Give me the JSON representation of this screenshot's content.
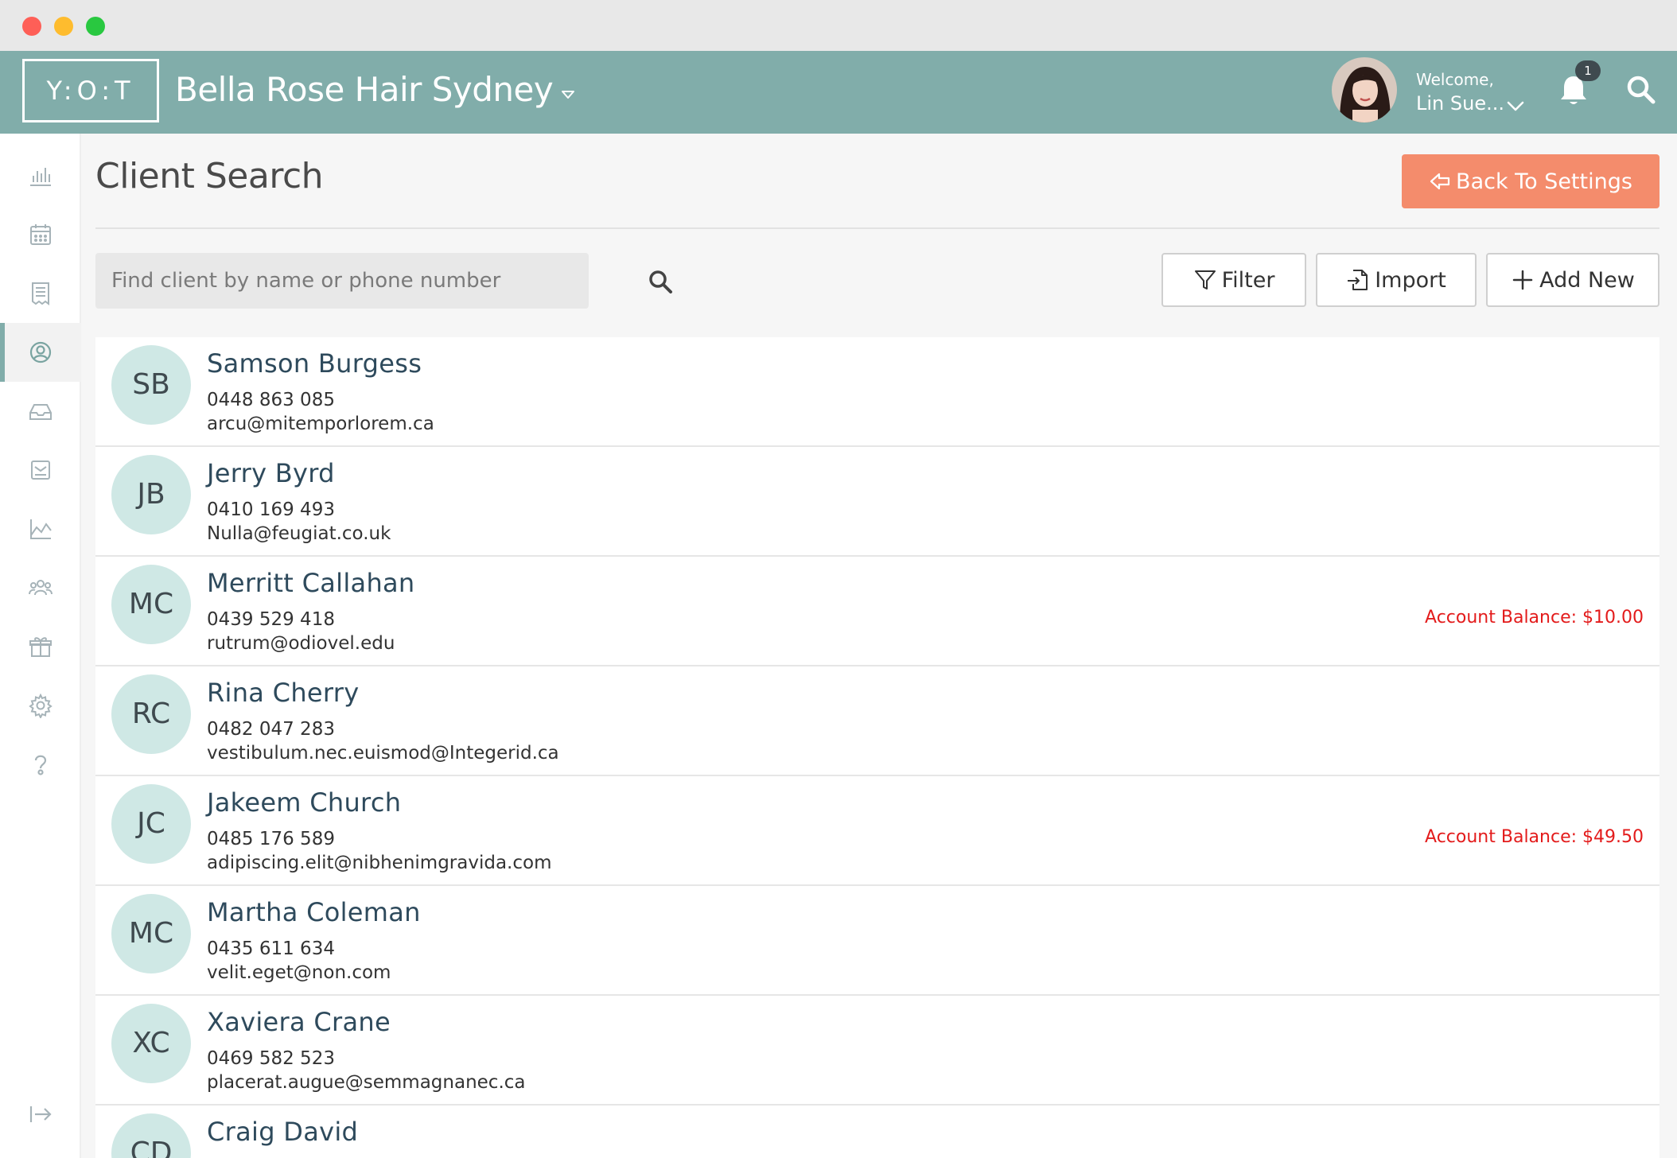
{
  "header": {
    "logo": "Y:O:T",
    "salon_name": "Bella Rose Hair Sydney",
    "welcome": "Welcome,",
    "username": "Lin Sue...",
    "notification_count": "1"
  },
  "sidebar": {
    "items": [
      {
        "icon": "bar-chart-icon"
      },
      {
        "icon": "calendar-icon"
      },
      {
        "icon": "receipt-icon"
      },
      {
        "icon": "user-circle-icon",
        "active": true
      },
      {
        "icon": "inbox-icon"
      },
      {
        "icon": "mail-box-icon"
      },
      {
        "icon": "area-chart-icon"
      },
      {
        "icon": "team-icon"
      },
      {
        "icon": "gift-box-icon"
      },
      {
        "icon": "gear-icon"
      },
      {
        "icon": "help-icon"
      }
    ],
    "logout_icon": "logout-icon"
  },
  "main": {
    "title": "Client Search",
    "back_button": "Back To Settings",
    "search_placeholder": "Find client by name or phone number",
    "filter_button": "Filter",
    "import_button": "Import",
    "add_button": "Add New"
  },
  "clients": [
    {
      "initials": "SB",
      "name": "Samson Burgess",
      "phone": "0448 863 085",
      "email": "arcu@mitemporlorem.ca",
      "balance": ""
    },
    {
      "initials": "JB",
      "name": "Jerry Byrd",
      "phone": "0410 169 493",
      "email": "Nulla@feugiat.co.uk",
      "balance": ""
    },
    {
      "initials": "MC",
      "name": "Merritt Callahan",
      "phone": "0439 529 418",
      "email": "rutrum@odiovel.edu",
      "balance": "Account Balance: $10.00"
    },
    {
      "initials": "RC",
      "name": "Rina Cherry",
      "phone": "0482 047 283",
      "email": "vestibulum.nec.euismod@Integerid.ca",
      "balance": ""
    },
    {
      "initials": "JC",
      "name": "Jakeem Church",
      "phone": "0485 176 589",
      "email": "adipiscing.elit@nibhenimgravida.com",
      "balance": "Account Balance: $49.50"
    },
    {
      "initials": "MC",
      "name": "Martha Coleman",
      "phone": "0435 611 634",
      "email": "velit.eget@non.com",
      "balance": ""
    },
    {
      "initials": "XC",
      "name": "Xaviera Crane",
      "phone": "0469 582 523",
      "email": "placerat.augue@semmagnanec.ca",
      "balance": ""
    },
    {
      "initials": "CD",
      "name": "Craig David",
      "phone": "",
      "email": "",
      "balance": ""
    }
  ],
  "colors": {
    "header": "#81adaa",
    "accent_button": "#f48c6c",
    "avatar_bg": "#cfe8e5",
    "balance_text": "#e31b1b"
  }
}
